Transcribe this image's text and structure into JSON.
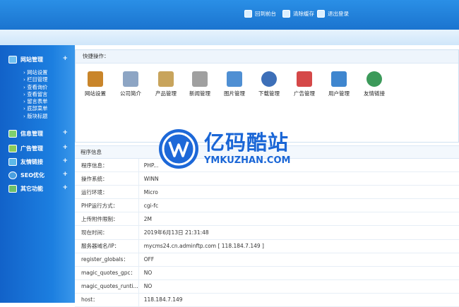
{
  "header": {
    "links": [
      {
        "label": "回到前台",
        "icon": "home-icon"
      },
      {
        "label": "清除缓存",
        "icon": "trash-icon"
      },
      {
        "label": "退出登录",
        "icon": "logout-icon"
      }
    ]
  },
  "sidebar": {
    "sections": [
      {
        "label": "网站管理",
        "toggle": "+",
        "icon": "site-icon"
      },
      {
        "label": "信息管理",
        "toggle": "+",
        "icon": "info-icon"
      },
      {
        "label": "广告管理",
        "toggle": "+",
        "icon": "ad-icon"
      },
      {
        "label": "友情链接",
        "toggle": "+",
        "icon": "link-icon"
      },
      {
        "label": "SEO优化",
        "toggle": "+",
        "icon": "seo-icon"
      },
      {
        "label": "其它功能",
        "toggle": "+",
        "icon": "other-icon"
      }
    ],
    "subitems": [
      "网站设置",
      "栏目管理",
      "查看询价",
      "查看留言",
      "留言表单",
      "底部菜单",
      "版块标题"
    ]
  },
  "quick": {
    "title": "快捷操作：",
    "items": [
      {
        "label": "网站设置",
        "icon": "house-icon",
        "color": "#c9852a"
      },
      {
        "label": "公司简介",
        "icon": "building-icon",
        "color": "#8da5c4"
      },
      {
        "label": "产品管理",
        "icon": "box-icon",
        "color": "#c8a45c"
      },
      {
        "label": "新闻管理",
        "icon": "newspaper-icon",
        "color": "#a0a0a0"
      },
      {
        "label": "图片管理",
        "icon": "image-icon",
        "color": "#4f8fd3"
      },
      {
        "label": "下载管理",
        "icon": "download-icon",
        "color": "#3d6fb8"
      },
      {
        "label": "广告管理",
        "icon": "billboard-icon",
        "color": "#d54848"
      },
      {
        "label": "用户管理",
        "icon": "user-icon",
        "color": "#3f86cf"
      },
      {
        "label": "友情链接",
        "icon": "globe-icon",
        "color": "#3c9a5a"
      }
    ]
  },
  "info": {
    "title": "程序信息",
    "rows": [
      {
        "key": "程序信息：",
        "value": "PHP..."
      },
      {
        "key": "操作系统：",
        "value": "WINN"
      },
      {
        "key": "运行环境：",
        "value": "Micro"
      },
      {
        "key": "PHP运行方式：",
        "value": "cgi-fc"
      },
      {
        "key": "上传附件限制：",
        "value": "2M"
      },
      {
        "key": "现在时间：",
        "value": "2019年6月13日 21:31:48"
      },
      {
        "key": "服务器域名/IP：",
        "value": "mycms24.cn.adminftp.com [ 118.184.7.149 ]"
      },
      {
        "key": "register_globals：",
        "value": "OFF"
      },
      {
        "key": "magic_quotes_gpc：",
        "value": "NO"
      },
      {
        "key": "magic_quotes_runti...",
        "value": "NO"
      },
      {
        "key": "host：",
        "value": "118.184.7.149"
      }
    ]
  },
  "watermark": {
    "cn": "亿码酷站",
    "en": "YMKUZHAN.COM"
  },
  "colors": {
    "header": "#1b74cf",
    "sidebar": "#1470d6",
    "accent": "#1a66d6"
  }
}
